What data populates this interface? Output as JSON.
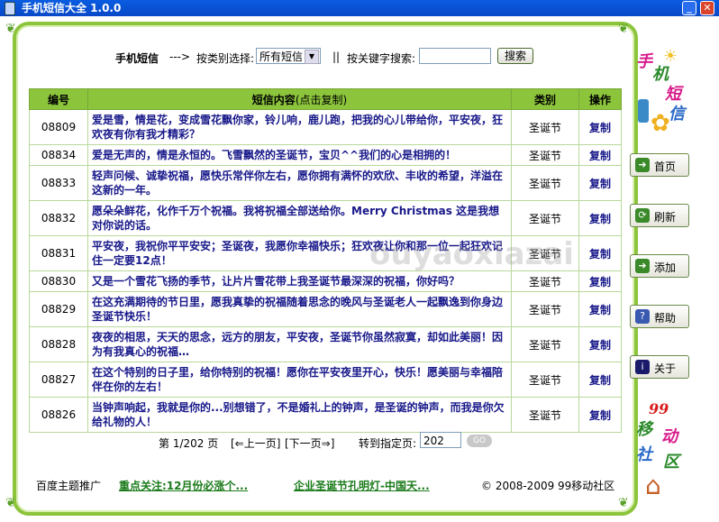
{
  "window": {
    "title": "手机短信大全 1.0.0"
  },
  "toolbar": {
    "app_label": "手机短信",
    "arrow": "--->",
    "category_label": "按类别选择:",
    "category_value": "所有短信",
    "separator": "||",
    "keyword_label": "按关键字搜索:",
    "keyword_value": "",
    "search_button": "搜索"
  },
  "table": {
    "headers": {
      "id": "编号",
      "content": "短信内容",
      "content_hint": "(点击复制)",
      "category": "类别",
      "action": "操作"
    },
    "rows": [
      {
        "id": "08809",
        "text": "爱是雪，情是花，变成雪花飘你家，铃儿响，鹿儿跑，把我的心儿带给你，平安夜，狂欢夜有你有我才精彩？",
        "category": "圣诞节",
        "action": "复制"
      },
      {
        "id": "08834",
        "text": "爱是无声的，情是永恒的。飞雪飘然的圣诞节，宝贝^^我们的心是相拥的！",
        "category": "圣诞节",
        "action": "复制"
      },
      {
        "id": "08833",
        "text": "轻声问候、诚挚祝福，愿快乐常伴你左右，愿你拥有满怀的欢欣、丰收的希望，洋溢在这新的一年。",
        "category": "圣诞节",
        "action": "复制"
      },
      {
        "id": "08832",
        "text": "愿朵朵鲜花，化作千万个祝福。我将祝福全部送给你。Merry Christmas 这是我想对你说的话。",
        "category": "圣诞节",
        "action": "复制"
      },
      {
        "id": "08831",
        "text": "平安夜，我祝你平平安安；圣诞夜，我愿你幸福快乐；狂欢夜让你和那一位一起狂欢记住一定要12点！",
        "category": "圣诞节",
        "action": "复制"
      },
      {
        "id": "08830",
        "text": "又是一个雪花飞扬的季节，让片片雪花带上我圣诞节最深深的祝福，你好吗？",
        "category": "圣诞节",
        "action": "复制"
      },
      {
        "id": "08829",
        "text": "在这充满期待的节日里，愿我真挚的祝福随着思念的晚风与圣诞老人一起飘逸到你身边圣诞节快乐！",
        "category": "圣诞节",
        "action": "复制"
      },
      {
        "id": "08828",
        "text": "夜夜的相思，天天的思念，远方的朋友，平安夜，圣诞节你虽然寂寞，却如此美丽！因为有我真心的祝福…",
        "category": "圣诞节",
        "action": "复制"
      },
      {
        "id": "08827",
        "text": "在这个特别的日子里，给你特别的祝福！愿你在平安夜里开心，快乐！愿美丽与幸福陪伴在你的左右！",
        "category": "圣诞节",
        "action": "复制"
      },
      {
        "id": "08826",
        "text": "当钟声响起，我就是你的...别想错了，不是婚礼上的钟声，是圣诞的钟声，而我是你欠给礼物的人！",
        "category": "圣诞节",
        "action": "复制"
      }
    ]
  },
  "pager": {
    "page_text": "第 1/202 页",
    "prev": "[⇐上一页]",
    "next": "[下一页⇒]",
    "goto_label": "转到指定页:",
    "goto_value": "202",
    "go_button": "GO"
  },
  "footer": {
    "promo_label": "百度主题推广",
    "link1": "重点关注:12月份必涨个...",
    "link2": "企业圣诞节孔明灯-中国天...",
    "copyright": "© 2008-2009 99移动社区"
  },
  "sidebar": {
    "logo_top": [
      "手",
      "机",
      "短",
      "信"
    ],
    "buttons": [
      {
        "label": "首页",
        "icon": "home-arrow-icon",
        "color": "#3a8a2a"
      },
      {
        "label": "刷新",
        "icon": "refresh-icon",
        "color": "#3a8a2a"
      },
      {
        "label": "添加",
        "icon": "add-arrow-icon",
        "color": "#3a8a2a"
      },
      {
        "label": "帮助",
        "icon": "help-icon",
        "color": "#3a5ab0"
      },
      {
        "label": "关于",
        "icon": "info-icon",
        "color": "#1a1a6a"
      }
    ],
    "logo_bottom": [
      "99",
      "移",
      "动",
      "社",
      "区"
    ]
  },
  "watermark": "ouyaoxiazai"
}
